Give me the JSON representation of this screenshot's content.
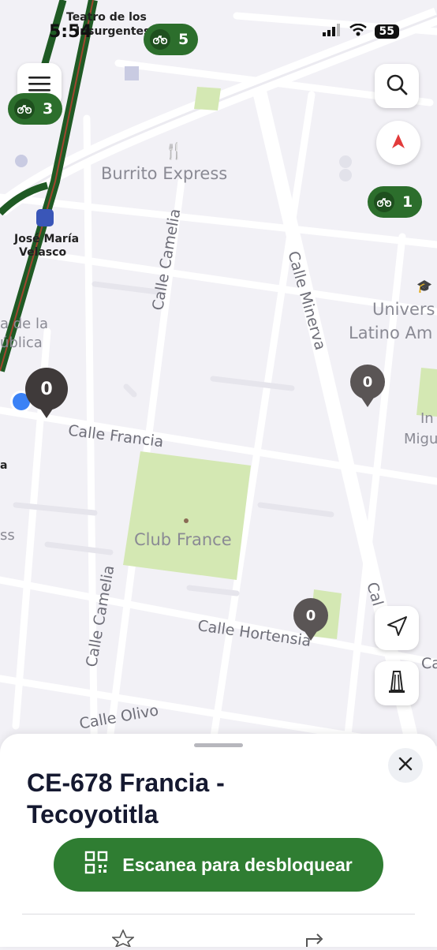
{
  "status_bar": {
    "time": "5:54",
    "battery": "55"
  },
  "map": {
    "streets": {
      "calle_camelia_upper": "Calle Camelia",
      "calle_camelia_lower": "Calle Camelia",
      "calle_minerva": "Calle Minerva",
      "calle_francia": "Calle Francia",
      "calle_hortensia": "Calle Hortensia",
      "calle_olivo": "Calle Olivo",
      "calle_partial_right": "Cal",
      "calle_partial_edge": "Ca"
    },
    "pois": {
      "burrito_express": "Burrito Express",
      "club_france": "Club France",
      "universidad_line1": "Univers",
      "universidad_line2": "Latino Am",
      "teatro_line1": "Teatro de los",
      "teatro_line2": "Insurgentes",
      "jose_maria_line1": "José María",
      "jose_maria_line2": "Velasco",
      "left_edge_line1": "a de la",
      "left_edge_line2": "ública",
      "right_edge_line1": "In",
      "right_edge_line2": "Migu",
      "edge_a": "a",
      "edge_ss": "ss"
    },
    "clusters": [
      {
        "count": "5"
      },
      {
        "count": "3"
      },
      {
        "count": "1"
      }
    ],
    "pins": [
      {
        "count": "0"
      },
      {
        "count": "0"
      },
      {
        "count": "0"
      }
    ]
  },
  "station": {
    "title": "CE-678 Francia - Tecoyotitla",
    "cta_label": "Escanea para desbloquear"
  },
  "colors": {
    "accent_green": "#2f7d32",
    "cluster_green": "#2c6e2c",
    "park_green": "#d4e8b3",
    "pin_gray": "#5a5555"
  },
  "icons": {
    "menu": "hamburger-icon",
    "search": "search-icon",
    "compass": "compass-icon",
    "locate": "location-arrow-icon",
    "monument": "monument-icon",
    "close": "close-icon",
    "qr": "qr-code-icon",
    "bike": "bike-icon",
    "star": "star-icon",
    "share": "share-icon"
  }
}
